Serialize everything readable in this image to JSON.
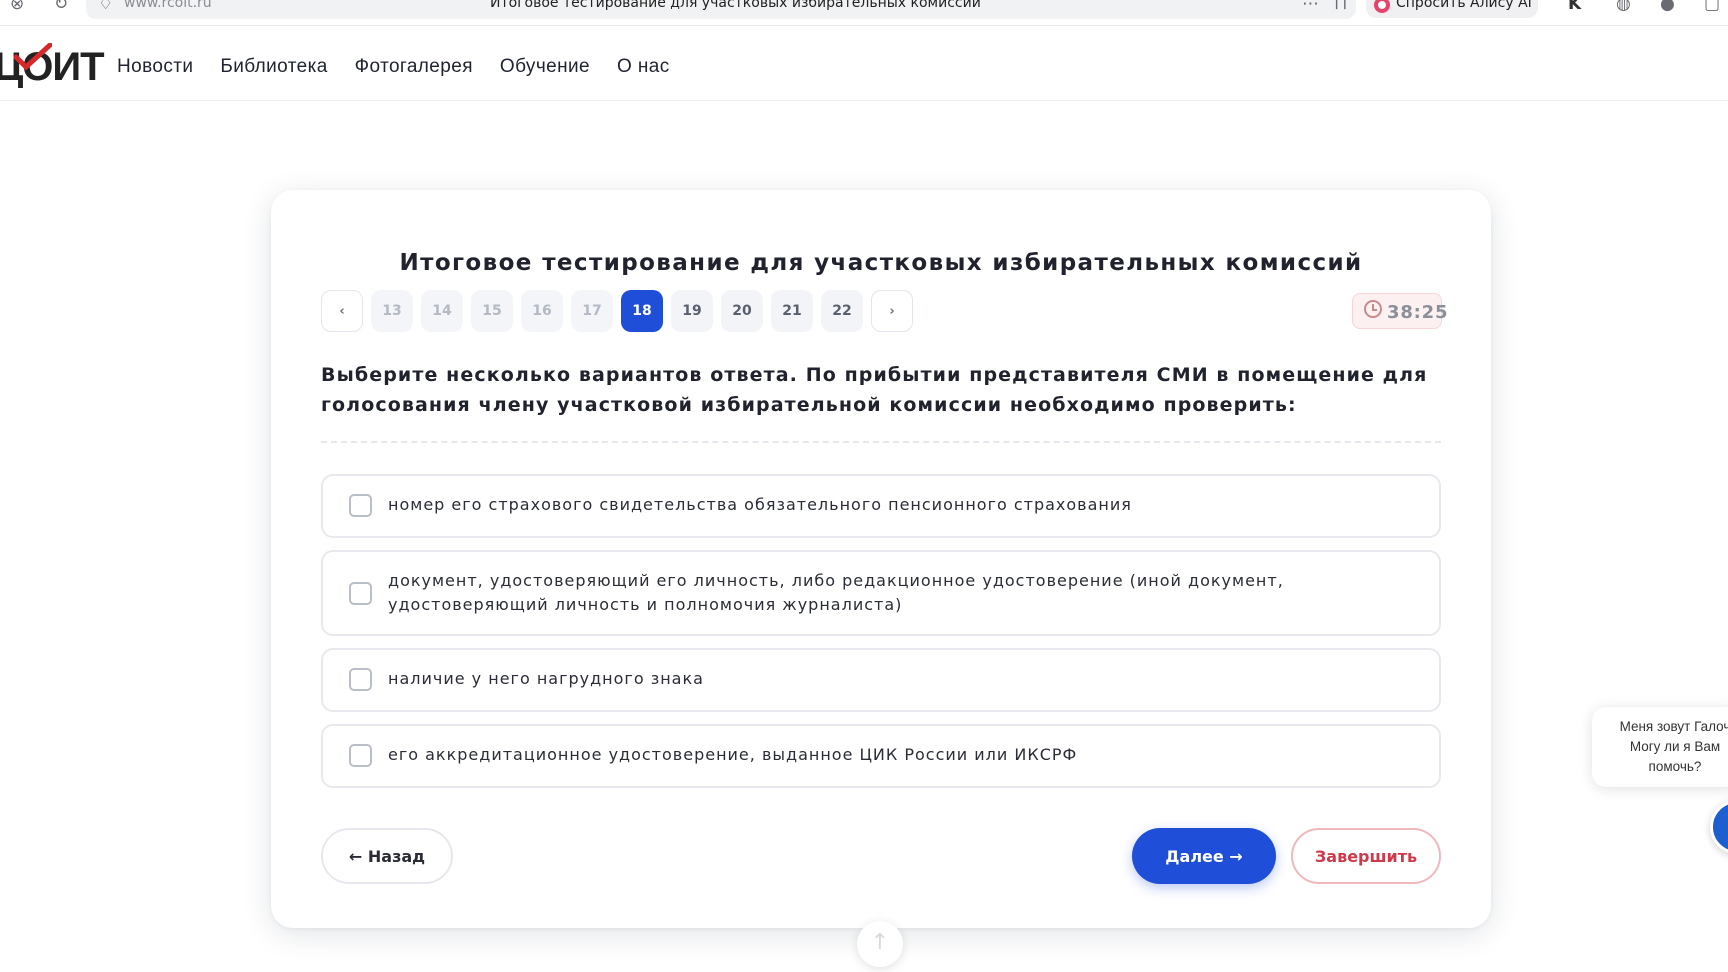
{
  "browser": {
    "url": "www.rcoit.ru",
    "tab_title": "Итоговое тестирование для участковых избирательных комиссий",
    "alice_label": "Спросить Алису AI"
  },
  "site": {
    "logo_text": "ЦОИТ",
    "nav": [
      "Новости",
      "Библиотека",
      "Фотогалерея",
      "Обучение",
      "О нас"
    ]
  },
  "test": {
    "title": "Итоговое тестирование для участковых избирательных комиссий",
    "pager": {
      "prev_label": "‹",
      "next_label": "›",
      "pages": [
        "13",
        "14",
        "15",
        "16",
        "17",
        "18",
        "19",
        "20",
        "21",
        "22"
      ],
      "current": "18"
    },
    "timer": "38:25",
    "question": "Выберите несколько вариантов ответа. По прибытии представителя СМИ в помещение для голосования члену участковой избирательной комиссии необходимо проверить:",
    "options": [
      "номер его страхового свидетельства обязательного пенсионного страхования",
      "документ, удостоверяющий его личность, либо редакционное удостоверение (иной документ, удостоверяющий личность и полномочия журналиста)",
      "наличие у него нагрудного знака",
      "его аккредитационное удостоверение, выданное ЦИК России или ИКСРФ"
    ],
    "buttons": {
      "back": "← Назад",
      "next": "Далее →",
      "finish": "Завершить"
    }
  },
  "chat": {
    "message": "Меня зовут Галоч\nМогу ли я Вам\nпомочь?"
  },
  "colors": {
    "accent": "#1f4fd8",
    "finish": "#d0394a"
  }
}
